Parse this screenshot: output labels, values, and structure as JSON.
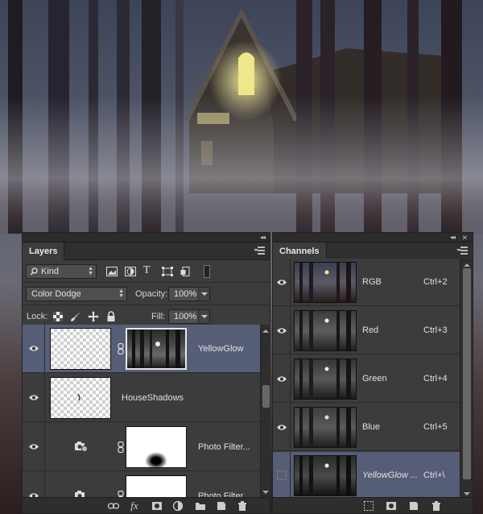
{
  "layers_panel": {
    "tab_label": "Layers",
    "filter_kind": "Kind",
    "blend_mode": "Color Dodge",
    "opacity_label": "Opacity:",
    "opacity_value": "100%",
    "lock_label": "Lock:",
    "fill_label": "Fill:",
    "fill_value": "100%",
    "layers": [
      {
        "name": "YellowGlow",
        "selected": true
      },
      {
        "name": "HouseShadows",
        "selected": false
      },
      {
        "name": "Photo Filter...",
        "selected": false
      },
      {
        "name": "Photo Filter...",
        "selected": false
      }
    ],
    "bottom_icons": [
      "link-icon",
      "fx-icon",
      "mask-icon",
      "adjustment-icon",
      "folder-icon",
      "new-layer-icon",
      "trash-icon"
    ],
    "fx_label": "fx"
  },
  "channels_panel": {
    "tab_label": "Channels",
    "channels": [
      {
        "name": "RGB",
        "shortcut": "Ctrl+2"
      },
      {
        "name": "Red",
        "shortcut": "Ctrl+3"
      },
      {
        "name": "Green",
        "shortcut": "Ctrl+4"
      },
      {
        "name": "Blue",
        "shortcut": "Ctrl+5"
      },
      {
        "name": "YellowGlow ...",
        "shortcut": "Ctrl+\\"
      }
    ],
    "bottom_icons": [
      "selection-icon",
      "mask-icon",
      "new-channel-icon",
      "trash-icon"
    ]
  },
  "colors": {
    "panel_bg": "#3c3c3c",
    "selected_row": "#565e77",
    "glow": "#e8e47a"
  }
}
